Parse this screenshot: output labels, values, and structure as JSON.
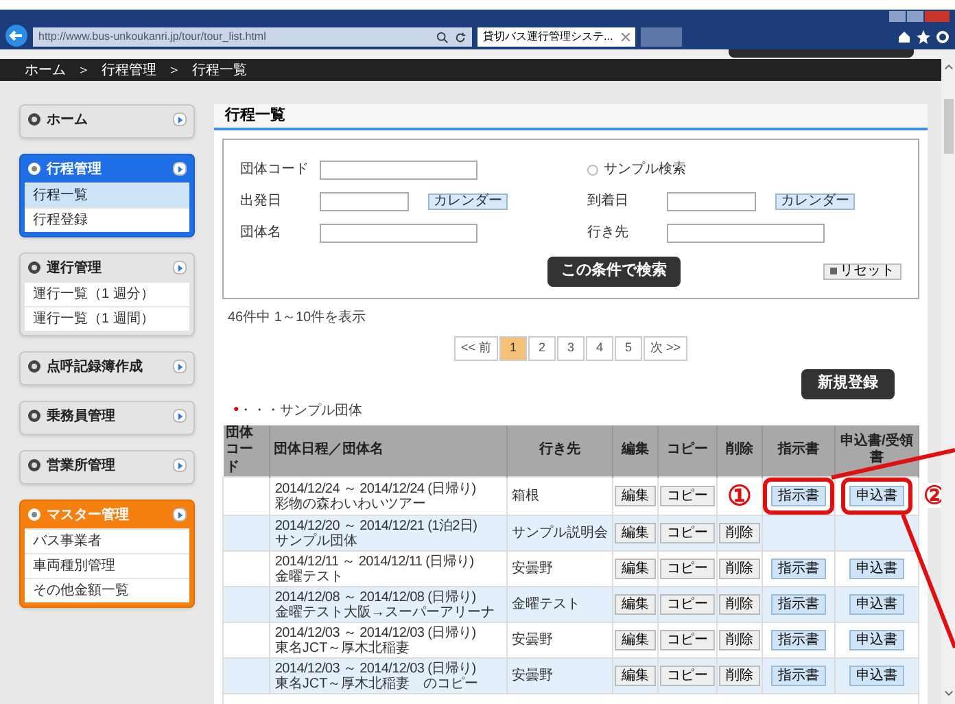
{
  "browser": {
    "url": "http://www.bus-unkoukanri.jp/tour/tour_list.html",
    "tab_title": "貸切バス運行管理システ..."
  },
  "breadcrumb": [
    "ホーム",
    "＞",
    "行程管理",
    "＞",
    "行程一覧"
  ],
  "sidebar": [
    {
      "title": "ホーム",
      "kind": "standard"
    },
    {
      "title": "行程管理",
      "kind": "current",
      "items": [
        {
          "label": "行程一覧",
          "selected": true
        },
        {
          "label": "行程登録",
          "selected": false
        }
      ]
    },
    {
      "title": "運行管理",
      "kind": "standard",
      "items": [
        {
          "label": "運行一覧（1 週分）",
          "selected": false
        },
        {
          "label": "運行一覧（1 週間）",
          "selected": false
        }
      ]
    },
    {
      "title": "点呼記録簿作成",
      "kind": "standard"
    },
    {
      "title": "乗務員管理",
      "kind": "standard"
    },
    {
      "title": "営業所管理",
      "kind": "standard"
    },
    {
      "title": "マスター管理",
      "kind": "master",
      "items": [
        {
          "label": "バス事業者",
          "selected": false
        },
        {
          "label": "車両種別管理",
          "selected": false
        },
        {
          "label": "その他金額一覧",
          "selected": false
        }
      ]
    }
  ],
  "page_title": "行程一覧",
  "search_form": {
    "fields": [
      {
        "kind": "text",
        "label": "団体コード"
      },
      {
        "kind": "radio",
        "label": "サンプル検索",
        "checked": false
      },
      {
        "kind": "date",
        "label": "出発日",
        "button": "カレンダー"
      },
      {
        "kind": "date",
        "label": "到着日",
        "button": "カレンダー"
      },
      {
        "kind": "text",
        "label": "団体名"
      },
      {
        "kind": "text",
        "label": "行き先"
      }
    ],
    "search_button": "この条件で検索",
    "reset_button": "リセット"
  },
  "result_count": "46件中 1～10件を表示",
  "pagination": [
    {
      "label": "<< 前",
      "selected": false
    },
    {
      "label": "1",
      "selected": true
    },
    {
      "label": "2",
      "selected": false
    },
    {
      "label": "3",
      "selected": false
    },
    {
      "label": "4",
      "selected": false
    },
    {
      "label": "5",
      "selected": false
    },
    {
      "label": "次 >>",
      "selected": false
    }
  ],
  "new_button": "新規登録",
  "legend": {
    "mark": "●",
    "text": "・・・サンプル団体"
  },
  "table": {
    "columns": [
      "団体コード",
      "団体日程／団体名",
      "行き先",
      "編集",
      "コピー",
      "削除",
      "指示書",
      "申込書/受領書"
    ],
    "rows": [
      {
        "schedule": "2014/12/24 ～ 2014/12/24 (日帰り)",
        "name": "彩物の森わいわいツアー",
        "destination": "箱根",
        "actions": {
          "edit": "編集",
          "copy": "コピー",
          "instruction": "指示書",
          "application": "申込書"
        },
        "outlined": true
      },
      {
        "schedule": "2014/12/20 ～ 2014/12/21 (1泊2日)",
        "name": "サンプル団体",
        "destination": "サンプル説明会",
        "actions": {
          "edit": "編集",
          "copy": "コピー",
          "delete": "削除"
        },
        "outlined": false
      },
      {
        "schedule": "2014/12/11 ～ 2014/12/11 (日帰り)",
        "name": "金曜テスト",
        "destination": "安曇野",
        "actions": {
          "edit": "編集",
          "copy": "コピー",
          "delete": "削除",
          "instruction": "指示書",
          "application": "申込書"
        },
        "outlined": false
      },
      {
        "schedule": "2014/12/08 ～ 2014/12/08 (日帰り)",
        "name": "金曜テスト大阪→スーパーアリーナ",
        "destination": "金曜テスト",
        "actions": {
          "edit": "編集",
          "copy": "コピー",
          "delete": "削除",
          "instruction": "指示書",
          "application": "申込書"
        },
        "outlined": false
      },
      {
        "schedule": "2014/12/03 ～ 2014/12/03 (日帰り)",
        "name": "東名JCT～厚木北稲妻",
        "destination": "安曇野",
        "actions": {
          "edit": "編集",
          "copy": "コピー",
          "delete": "削除",
          "instruction": "指示書",
          "application": "申込書"
        },
        "outlined": false
      },
      {
        "schedule": "2014/12/03 ～ 2014/12/03 (日帰り)",
        "name": "東名JCT～厚木北稲妻　のコピー",
        "destination": "安曇野",
        "actions": {
          "edit": "編集",
          "copy": "コピー",
          "delete": "削除",
          "instruction": "指示書",
          "application": "申込書"
        },
        "outlined": false
      }
    ]
  },
  "annotations": [
    {
      "label": "①"
    },
    {
      "label": "②"
    }
  ]
}
